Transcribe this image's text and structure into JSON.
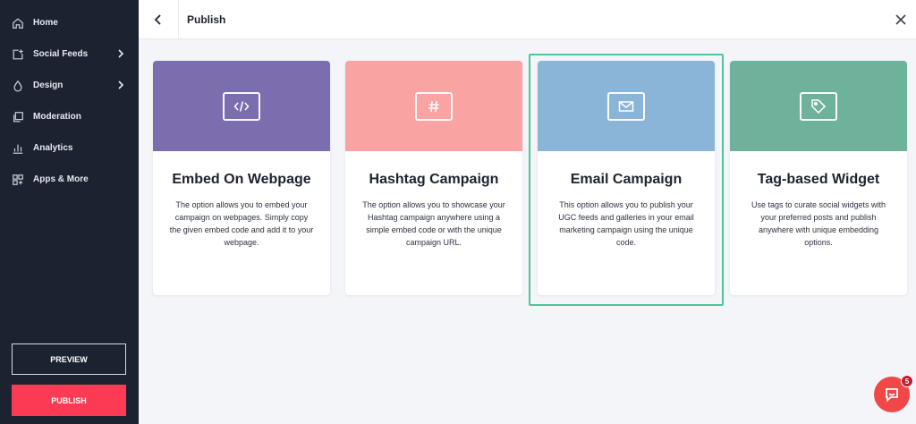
{
  "sidebar": {
    "items": [
      {
        "label": "Home",
        "icon": "home-icon",
        "has_chevron": false
      },
      {
        "label": "Social Feeds",
        "icon": "add-feed-icon",
        "has_chevron": true
      },
      {
        "label": "Design",
        "icon": "droplet-icon",
        "has_chevron": true
      },
      {
        "label": "Moderation",
        "icon": "moderation-icon",
        "has_chevron": false
      },
      {
        "label": "Analytics",
        "icon": "bar-chart-icon",
        "has_chevron": false
      },
      {
        "label": "Apps & More",
        "icon": "apps-icon",
        "has_chevron": false
      }
    ],
    "preview_label": "PREVIEW",
    "publish_label": "PUBLISH"
  },
  "header": {
    "title": "Publish"
  },
  "cards": [
    {
      "title": "Embed On Webpage",
      "description": "The option allows you to embed your campaign on webpages. Simply copy the given embed code and add it to your webpage.",
      "icon": "code-icon",
      "color": "#7c6eae",
      "selected": false
    },
    {
      "title": "Hashtag Campaign",
      "description": "The option allows you to showcase your Hashtag campaign anywhere using a simple embed code or with the unique campaign URL.",
      "icon": "hashtag-icon",
      "color": "#f9a3a3",
      "selected": false
    },
    {
      "title": "Email Campaign",
      "description": "This option allows you to publish your UGC feeds and galleries in your email marketing campaign using the unique code.",
      "icon": "envelope-icon",
      "color": "#8bb5d8",
      "selected": true
    },
    {
      "title": "Tag-based Widget",
      "description": "Use tags to curate social widgets with your preferred posts and publish anywhere with unique embedding options.",
      "icon": "tag-icon",
      "color": "#6fb29c",
      "selected": false
    }
  ],
  "colors": {
    "sidebar_bg": "#1c2330",
    "publish_button": "#fb3b54",
    "selected_border": "#4ec59a",
    "chat_button": "#f24747"
  },
  "chat": {
    "icon": "chat-icon",
    "badge_count": "5"
  }
}
